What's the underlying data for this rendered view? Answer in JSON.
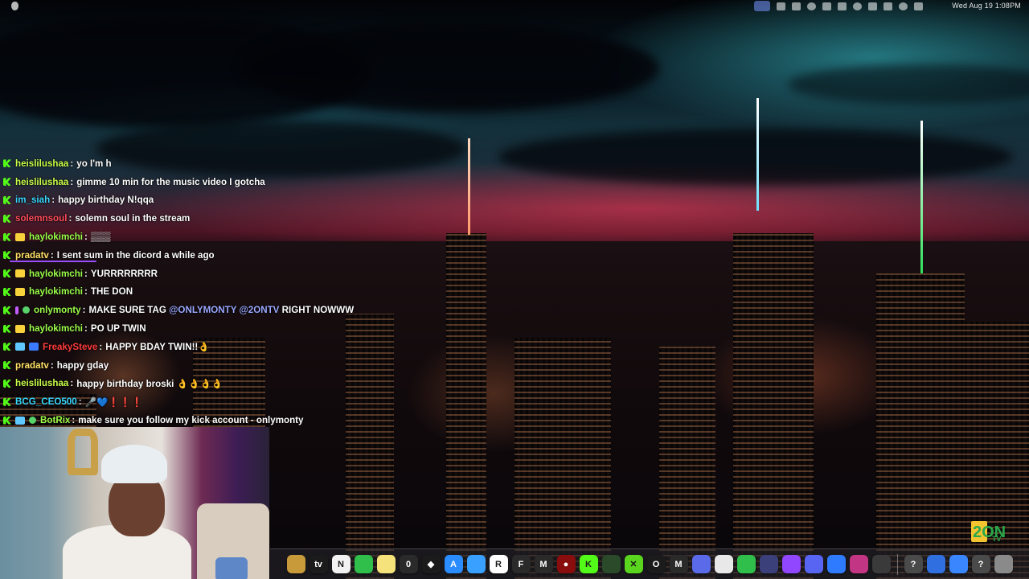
{
  "menubar": {
    "clock": "Wed Aug 19  1:08PM",
    "status_icons": [
      "screen-share-icon",
      "camera-icon",
      "pip-icon",
      "moon-icon",
      "display-icon",
      "window-icon",
      "play-icon",
      "battery-icon",
      "wifi-icon",
      "search-icon",
      "control-center-icon"
    ]
  },
  "chat": {
    "messages": [
      {
        "badges": [
          "kick"
        ],
        "user": "heislilushaa",
        "color": "#c9ff4a",
        "text": "yo I'm h"
      },
      {
        "badges": [
          "kick"
        ],
        "user": "heislilushaa",
        "color": "#c9ff4a",
        "text": "gimme 10 min for the music video I gotcha"
      },
      {
        "badges": [
          "kick"
        ],
        "user": "im_siah",
        "color": "#39d8ff",
        "text": "happy birthday N!qqa"
      },
      {
        "badges": [
          "kick"
        ],
        "user": "solemnsoul",
        "color": "#ff4d5a",
        "text": "solemn soul in the stream"
      },
      {
        "badges": [
          "kick",
          "sub"
        ],
        "user": "haylokimchi",
        "color": "#9cff4a",
        "text": "▒▒▒"
      },
      {
        "badges": [
          "kick"
        ],
        "user": "pradatv",
        "color": "#ffe066",
        "text": "I sent sum in the dicord a while ago"
      },
      {
        "badges": [
          "kick",
          "sub"
        ],
        "user": "haylokimchi",
        "color": "#9cff4a",
        "text": "YURRRRRRRR"
      },
      {
        "badges": [
          "kick",
          "sub"
        ],
        "user": "haylokimchi",
        "color": "#9cff4a",
        "text": "THE DON"
      },
      {
        "badges": [
          "kick",
          "vip",
          "mod"
        ],
        "user": "onlymonty",
        "color": "#9cff4a",
        "text_parts": [
          "MAKE SURE TAG ",
          "@ONLYMONTY @2ONTV",
          " RIGHT NOWWW"
        ]
      },
      {
        "badges": [
          "kick",
          "sub"
        ],
        "user": "haylokimchi",
        "color": "#9cff4a",
        "text": "PO UP TWIN"
      },
      {
        "badges": [
          "kick",
          "og",
          "bot"
        ],
        "user": "FreakySteve",
        "color": "#ff3b3b",
        "text": "HAPPY BDAY TWIN!!👌"
      },
      {
        "badges": [
          "kick"
        ],
        "user": "pradatv",
        "color": "#ffe066",
        "text": "happy gday"
      },
      {
        "badges": [
          "kick"
        ],
        "user": "heislilushaa",
        "color": "#c9ff4a",
        "text": "happy birthday broski 👌👌👌👌"
      },
      {
        "badges": [
          "kick"
        ],
        "user": "BCG_CEO500",
        "color": "#39d8ff",
        "text": "🎤💙❗❗❗"
      },
      {
        "badges": [
          "kick",
          "og",
          "mod"
        ],
        "user": "BotRix",
        "color": "#9cff4a",
        "text": "make sure you follow my kick account - onlymonty"
      }
    ]
  },
  "dock": {
    "apps": [
      {
        "name": "finder-icon",
        "label": "",
        "bg": "#c89a3a"
      },
      {
        "name": "apple-tv-icon",
        "label": "tv",
        "bg": "#1b1b1b"
      },
      {
        "name": "news-icon",
        "label": "N",
        "bg": "#f2f2f2"
      },
      {
        "name": "numbers-icon",
        "label": "",
        "bg": "#2fbf4a"
      },
      {
        "name": "notes-icon",
        "label": "",
        "bg": "#f6e27a"
      },
      {
        "name": "counter-icon",
        "label": "0",
        "bg": "#2a2a2a"
      },
      {
        "name": "capcut-icon",
        "label": "◆",
        "bg": "#1b1b1b"
      },
      {
        "name": "app-store-icon",
        "label": "A",
        "bg": "#2b8cff"
      },
      {
        "name": "preview-icon",
        "label": "",
        "bg": "#3aa0ff"
      },
      {
        "name": "roblox-icon",
        "label": "R",
        "bg": "#ffffff"
      },
      {
        "name": "font-app-icon",
        "label": "F",
        "bg": "#2a2a2a"
      },
      {
        "name": "metamask-icon",
        "label": "M",
        "bg": "#2a2a2a"
      },
      {
        "name": "record-icon",
        "label": "●",
        "bg": "#8a0d0d"
      },
      {
        "name": "kick-icon",
        "label": "K",
        "bg": "#53fc18"
      },
      {
        "name": "streamer-app-icon",
        "label": "",
        "bg": "#2a4a2a"
      },
      {
        "name": "clover-icon",
        "label": "✕",
        "bg": "#5ad61e"
      },
      {
        "name": "obs-icon",
        "label": "O",
        "bg": "#1b1b1b"
      },
      {
        "name": "mail-m-icon",
        "label": "M",
        "bg": "#2a2a2a"
      },
      {
        "name": "discord-bot-icon",
        "label": "",
        "bg": "#5a6ae8"
      },
      {
        "name": "chrome-icon",
        "label": "",
        "bg": "#e8e8e8"
      },
      {
        "name": "kick-green-icon",
        "label": "",
        "bg": "#2fbf4a"
      },
      {
        "name": "discord-dark-icon",
        "label": "",
        "bg": "#3b3f7a"
      },
      {
        "name": "twitch-icon",
        "label": "",
        "bg": "#9146ff"
      },
      {
        "name": "discord-icon",
        "label": "",
        "bg": "#5865f2"
      },
      {
        "name": "bluetooth-icon",
        "label": "",
        "bg": "#2f7bff"
      },
      {
        "name": "instagram-icon",
        "label": "",
        "bg": "#c13584"
      },
      {
        "name": "activity-monitor-icon",
        "label": "",
        "bg": "#3a3a3a"
      },
      {
        "name": "help-icon",
        "label": "?",
        "bg": "#4a4a4a"
      },
      {
        "name": "globe-icon",
        "label": "",
        "bg": "#2f6fe0"
      },
      {
        "name": "globe-2-icon",
        "label": "",
        "bg": "#3a86ff"
      },
      {
        "name": "help-2-icon",
        "label": "?",
        "bg": "#4a4a4a"
      },
      {
        "name": "trash-icon",
        "label": "",
        "bg": "#8a8a8a"
      }
    ]
  },
  "logo": {
    "text": "2ON",
    "sub": "TV"
  }
}
